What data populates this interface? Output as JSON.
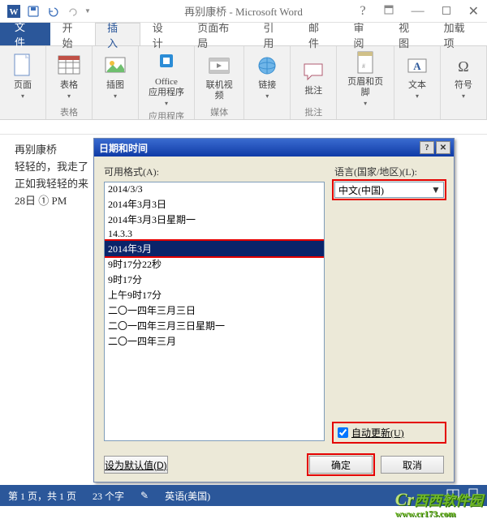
{
  "title": "再别康桥 - Microsoft Word",
  "tabs": {
    "file": "文件",
    "home": "开始",
    "insert": "插入",
    "design": "设计",
    "layout": "页面布局",
    "references": "引用",
    "mail": "邮件",
    "review": "审阅",
    "view": "视图",
    "addins": "加载项"
  },
  "groups": {
    "pages": {
      "btn": "页面",
      "label": ""
    },
    "tables": {
      "btn": "表格",
      "label": "表格"
    },
    "illus": {
      "btn": "插图",
      "label": ""
    },
    "apps": {
      "btn": "Office\n应用程序",
      "label": "应用程序"
    },
    "video": {
      "btn": "联机视频",
      "label": "媒体"
    },
    "links": {
      "btn": "链接",
      "label": ""
    },
    "comment": {
      "btn": "批注",
      "label": "批注"
    },
    "header": {
      "btn": "页眉和页脚",
      "label": ""
    },
    "text": {
      "btn": "文本",
      "label": ""
    },
    "symbol": {
      "btn": "符号",
      "label": ""
    }
  },
  "doc": {
    "l1": "再别康桥",
    "l2": "轻轻的，我走了",
    "l3": "正如我轻轻的来",
    "l4": "28日  ① PM"
  },
  "dialog": {
    "title": "日期和时间",
    "formats_label": "可用格式(A):",
    "lang_label": "语言(国家/地区)(L):",
    "lang_value": "中文(中国)",
    "auto_update": "自动更新(U)",
    "set_default": "设为默认值(D)",
    "ok": "确定",
    "cancel": "取消",
    "formats": [
      "2014/3/3",
      "2014年3月3日",
      "2014年3月3日星期一",
      "14.3.3",
      "2014年3月",
      "9时17分22秒",
      "9时17分",
      "上午9时17分",
      "二〇一四年三月三日",
      "二〇一四年三月三日星期一",
      "二〇一四年三月"
    ],
    "selected_index": 4
  },
  "status": {
    "page": "第 1 页，共 1 页",
    "words": "23 个字",
    "lang": "英语(美国)"
  },
  "watermark": {
    "main": "西西软件园",
    "url": "www.cr173.com"
  }
}
